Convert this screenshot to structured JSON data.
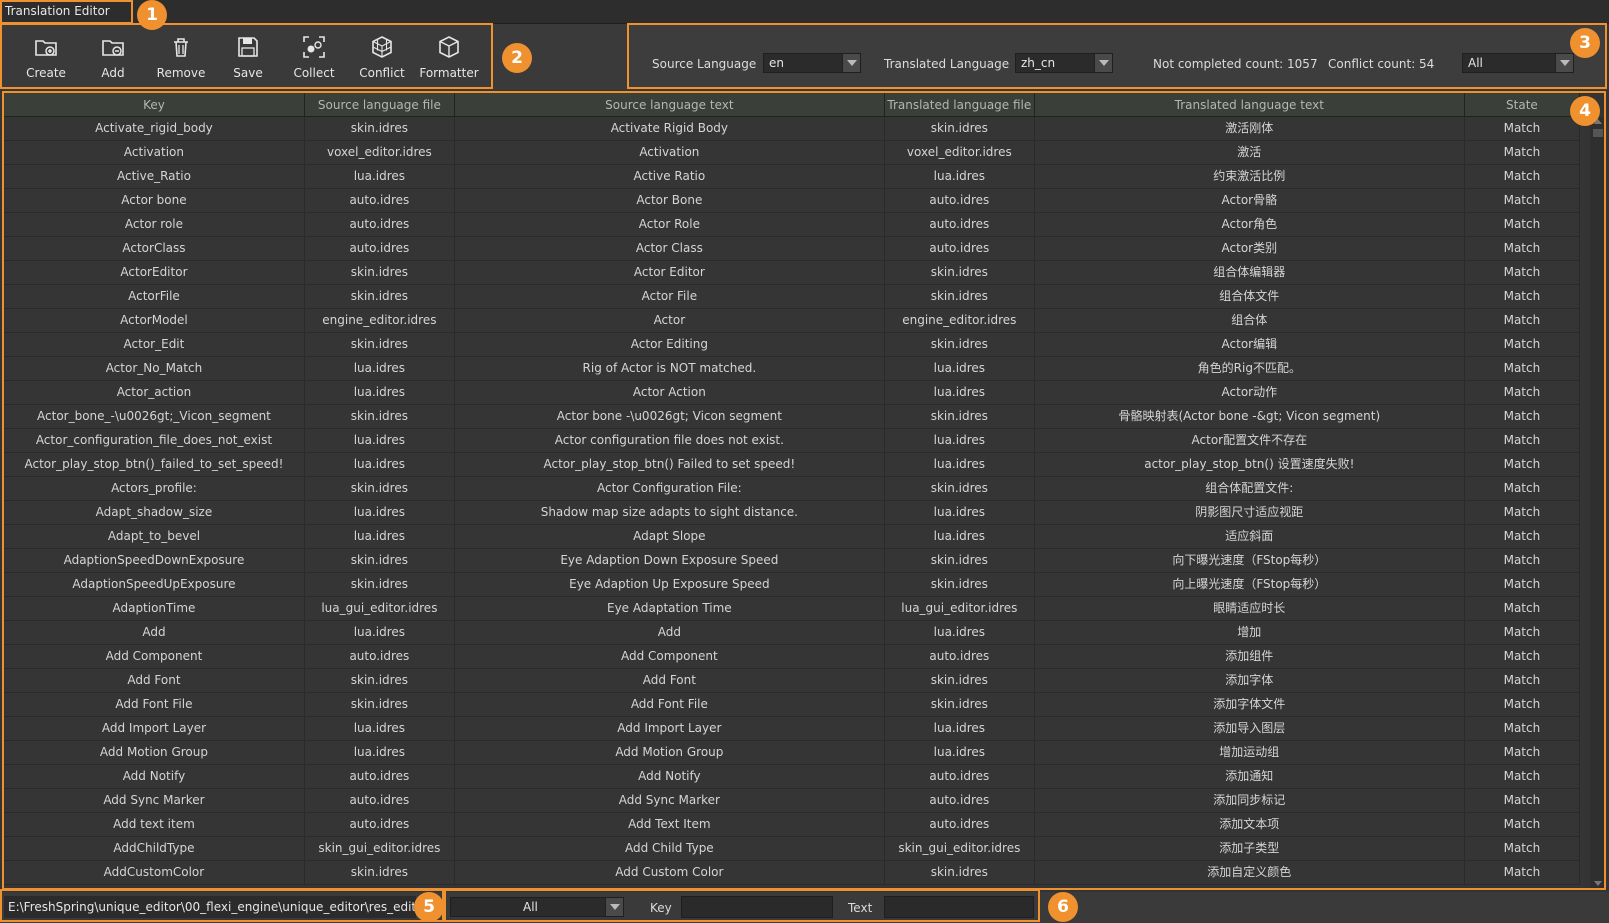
{
  "window": {
    "title": "Translation Editor"
  },
  "toolbar": {
    "buttons": [
      {
        "label": "Create",
        "icon": "folder-add-icon"
      },
      {
        "label": "Add",
        "icon": "folder-plus-icon"
      },
      {
        "label": "Remove",
        "icon": "trash-icon"
      },
      {
        "label": "Save",
        "icon": "save-icon"
      },
      {
        "label": "Collect",
        "icon": "collect-icon"
      },
      {
        "label": "Conflict",
        "icon": "cubes-icon"
      },
      {
        "label": "Formatter",
        "icon": "box-icon"
      }
    ]
  },
  "language": {
    "source_label": "Source Language",
    "source_value": "en",
    "translated_label": "Translated Language",
    "translated_value": "zh_cn",
    "not_completed": "Not completed count: 1057",
    "conflict": "Conflict count: 54",
    "filter_value": "All"
  },
  "table": {
    "columns": [
      "Key",
      "Source language file",
      "Source language text",
      "Translated language file",
      "Translated language text",
      "State"
    ],
    "rows": [
      [
        "Activate_rigid_body",
        "skin.idres",
        "Activate Rigid Body",
        "skin.idres",
        "激活刚体",
        "Match"
      ],
      [
        "Activation",
        "voxel_editor.idres",
        "Activation",
        "voxel_editor.idres",
        "激活",
        "Match"
      ],
      [
        "Active_Ratio",
        "lua.idres",
        "Active Ratio",
        "lua.idres",
        "约束激活比例",
        "Match"
      ],
      [
        "Actor bone",
        "auto.idres",
        "Actor Bone",
        "auto.idres",
        "Actor骨骼",
        "Match"
      ],
      [
        "Actor role",
        "auto.idres",
        "Actor Role",
        "auto.idres",
        "Actor角色",
        "Match"
      ],
      [
        "ActorClass",
        "auto.idres",
        "Actor Class",
        "auto.idres",
        "Actor类别",
        "Match"
      ],
      [
        "ActorEditor",
        "skin.idres",
        "Actor Editor",
        "skin.idres",
        "组合体编辑器",
        "Match"
      ],
      [
        "ActorFile",
        "skin.idres",
        "Actor File",
        "skin.idres",
        "组合体文件",
        "Match"
      ],
      [
        "ActorModel",
        "engine_editor.idres",
        "Actor",
        "engine_editor.idres",
        "组合体",
        "Match"
      ],
      [
        "Actor_Edit",
        "skin.idres",
        "Actor Editing",
        "skin.idres",
        "Actor编辑",
        "Match"
      ],
      [
        "Actor_No_Match",
        "lua.idres",
        "Rig of Actor is NOT matched.",
        "lua.idres",
        "角色的Rig不匹配。",
        "Match"
      ],
      [
        "Actor_action",
        "lua.idres",
        "Actor Action",
        "lua.idres",
        "Actor动作",
        "Match"
      ],
      [
        "Actor_bone_-\\u0026gt;_Vicon_segment",
        "skin.idres",
        "Actor bone -\\u0026gt; Vicon segment",
        "skin.idres",
        "骨骼映射表(Actor bone -&gt; Vicon segment)",
        "Match"
      ],
      [
        "Actor_configuration_file_does_not_exist",
        "lua.idres",
        "Actor configuration file does not exist.",
        "lua.idres",
        "Actor配置文件不存在",
        "Match"
      ],
      [
        "Actor_play_stop_btn()_failed_to_set_speed!",
        "lua.idres",
        "Actor_play_stop_btn() Failed to set speed!",
        "lua.idres",
        "actor_play_stop_btn() 设置速度失败!",
        "Match"
      ],
      [
        "Actors_profile:",
        "skin.idres",
        "Actor Configuration File:",
        "skin.idres",
        "组合体配置文件:",
        "Match"
      ],
      [
        "Adapt_shadow_size",
        "lua.idres",
        "Shadow map size adapts to sight distance.",
        "lua.idres",
        "阴影图尺寸适应视距",
        "Match"
      ],
      [
        "Adapt_to_bevel",
        "lua.idres",
        "Adapt Slope",
        "lua.idres",
        "适应斜面",
        "Match"
      ],
      [
        "AdaptionSpeedDownExposure",
        "skin.idres",
        "Eye Adaption Down Exposure Speed",
        "skin.idres",
        "向下曝光速度（FStop每秒）",
        "Match"
      ],
      [
        "AdaptionSpeedUpExposure",
        "skin.idres",
        "Eye Adaption Up Exposure Speed",
        "skin.idres",
        "向上曝光速度（FStop每秒）",
        "Match"
      ],
      [
        "AdaptionTime",
        "lua_gui_editor.idres",
        "Eye Adaptation Time",
        "lua_gui_editor.idres",
        "眼睛适应时长",
        "Match"
      ],
      [
        "Add",
        "lua.idres",
        "Add",
        "lua.idres",
        "增加",
        "Match"
      ],
      [
        "Add Component",
        "auto.idres",
        "Add Component",
        "auto.idres",
        "添加组件",
        "Match"
      ],
      [
        "Add Font",
        "skin.idres",
        "Add Font",
        "skin.idres",
        "添加字体",
        "Match"
      ],
      [
        "Add Font File",
        "skin.idres",
        "Add Font File",
        "skin.idres",
        "添加字体文件",
        "Match"
      ],
      [
        "Add Import Layer",
        "lua.idres",
        "Add Import Layer",
        "lua.idres",
        "添加导入图层",
        "Match"
      ],
      [
        "Add Motion Group",
        "lua.idres",
        "Add Motion Group",
        "lua.idres",
        "增加运动组",
        "Match"
      ],
      [
        "Add Notify",
        "auto.idres",
        "Add Notify",
        "auto.idres",
        "添加通知",
        "Match"
      ],
      [
        "Add Sync Marker",
        "auto.idres",
        "Add Sync Marker",
        "auto.idres",
        "添加同步标记",
        "Match"
      ],
      [
        "Add text item",
        "auto.idres",
        "Add Text Item",
        "auto.idres",
        "添加文本项",
        "Match"
      ],
      [
        "AddChildType",
        "skin_gui_editor.idres",
        "Add Child Type",
        "skin_gui_editor.idres",
        "添加子类型",
        "Match"
      ],
      [
        "AddCustomColor",
        "skin.idres",
        "Add Custom Color",
        "skin.idres",
        "添加自定义颜色",
        "Match"
      ]
    ]
  },
  "status": {
    "path": "E:\\FreshSpring\\unique_editor\\00_flexi_engine\\unique_editor\\res_edit",
    "filter_value": "All",
    "key_label": "Key",
    "text_label": "Text"
  },
  "badges": [
    "1",
    "2",
    "3",
    "4",
    "5",
    "6"
  ],
  "colors": {
    "accent": "#f0912f",
    "background": "#343434",
    "header": "#3a3f3a"
  }
}
